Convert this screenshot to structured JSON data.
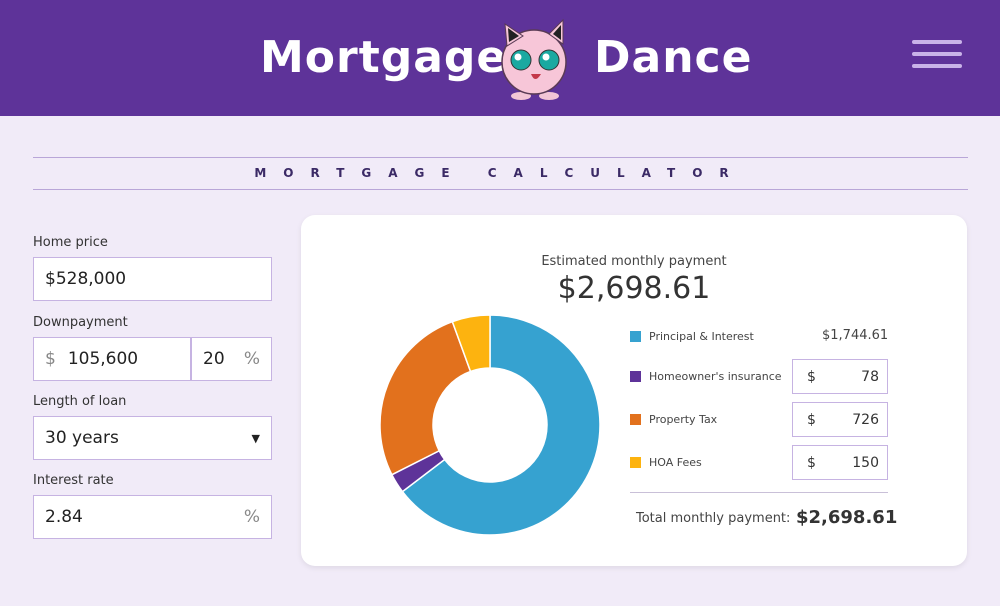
{
  "header": {
    "title_left": "Mortgage",
    "title_right": "Dance",
    "mascot": "jigglypuff-mascot",
    "menu_icon": "hamburger-icon"
  },
  "section_title": "MORTGAGE CALCULATOR",
  "form": {
    "home_price": {
      "label": "Home price",
      "value": "$528,000"
    },
    "downpayment": {
      "label": "Downpayment",
      "currency": "$",
      "value": "105,600",
      "percent": "20",
      "percent_sign": "%"
    },
    "loan_length": {
      "label": "Length of loan",
      "value": "30 years"
    },
    "interest": {
      "label": "Interest rate",
      "value": "2.84",
      "percent_sign": "%"
    }
  },
  "summary": {
    "estimated_label": "Estimated monthly payment",
    "estimated_value": "$2,698.61",
    "total_label": "Total monthly payment:",
    "total_value": "$2,698.61"
  },
  "breakdown": [
    {
      "label": "Principal & Interest",
      "value": "$1,744.61",
      "color": "#36a2d0"
    },
    {
      "label": "Homeowner's insurance",
      "currency": "$",
      "value": "78",
      "color": "#5e3399"
    },
    {
      "label": "Property Tax",
      "currency": "$",
      "value": "726",
      "color": "#e2711d"
    },
    {
      "label": "HOA Fees",
      "currency": "$",
      "value": "150",
      "color": "#fdb30f"
    }
  ],
  "chart_data": {
    "type": "pie",
    "donut": true,
    "categories": [
      "Principal & Interest",
      "Homeowner's insurance",
      "Property Tax",
      "HOA Fees"
    ],
    "values": [
      1744.61,
      78,
      726,
      150
    ],
    "colors": [
      "#36a2d0",
      "#5e3399",
      "#e2711d",
      "#fdb30f"
    ]
  }
}
